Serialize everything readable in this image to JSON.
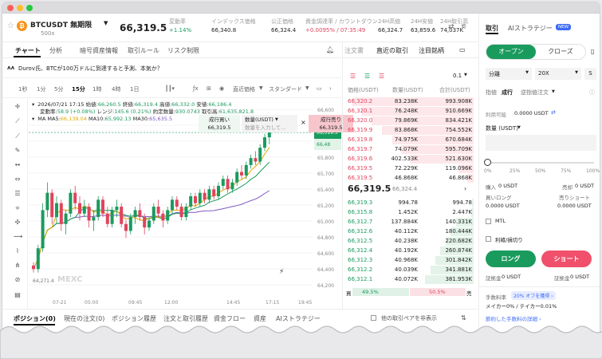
{
  "header": {
    "symbol": "BTCUSDT 無期限",
    "sub": "500x",
    "price": "66,319.5",
    "stats": [
      {
        "label": "変動率",
        "value": "+1.14%",
        "color": "green"
      },
      {
        "label": "インデックス価格",
        "value": "66,340.8",
        "color": "dark"
      },
      {
        "label": "公正価格",
        "value": "66,324.4",
        "color": "dark"
      },
      {
        "label": "資金調達率 / カウントダウン",
        "value": "+0.0095% / 07:35:49",
        "color": "red"
      },
      {
        "label": "24H高値",
        "value": "66,324.7",
        "color": "dark"
      },
      {
        "label": "24H安値",
        "value": "63,859.6",
        "color": "dark"
      },
      {
        "label": "24H取引高",
        "value": "74,037K",
        "color": "dark"
      }
    ]
  },
  "chart_tabs": [
    "チャート",
    "分析",
    "暗号資産情報",
    "取引ルール",
    "リスク制限"
  ],
  "news": "Durov氏、BTCが100万ドルに到達すると予測、本気か？",
  "intervals": [
    "1秒",
    "1分",
    "5分",
    "15分",
    "1時",
    "4時",
    "1日"
  ],
  "interval_active": "15分",
  "chart_menu": [
    "直近価格",
    "スタンダード"
  ],
  "ohlc": {
    "date": "2026/07/21 17:15",
    "open_l": "始値:",
    "open": "66,260.5",
    "close_l": "終値:",
    "close": "66,319.4",
    "high_l": "高値:",
    "high": "66,332.0",
    "low_l": "安値:",
    "low": "66,186.4",
    "chg_l": "変動率:",
    "chg": "58.9 (+0.08%)",
    "range_l": "レンジ:",
    "range": "145.6 (0.21%)",
    "vol_l": "約定数量:",
    "vol": "930.0743",
    "amt_l": "取引高:",
    "amt": "61,635,821.8"
  },
  "ma": {
    "label": "MA",
    "ma5_l": "MA5:",
    "ma5": "66,139.04",
    "ma10_l": "MA10:",
    "ma10": "65,992.13",
    "ma30_l": "MA30:",
    "ma30": "65,635.5"
  },
  "quick": {
    "buy_l": "成行買い",
    "buy": "66,319.5",
    "qty_l": "数量(USDT)",
    "qty_ph": "数量を入力して...",
    "sell_l": "成行売り",
    "sell": "66,319.5"
  },
  "price_axis": [
    "66,600",
    "66,400",
    "66,200",
    "65,800",
    "65,700",
    "65,400",
    "65,200",
    "65,000",
    "64,800",
    "64,600",
    "64,400",
    "64,200"
  ],
  "axis_current": "66,319.5",
  "axis_mark": "66,48",
  "time_axis": [
    "07-21",
    "05:00",
    "09:45",
    "12:00",
    "14:45",
    "17:15",
    "19:45"
  ],
  "chart_data": {
    "type": "candlestick",
    "low_label": "64,271.4",
    "watermark": "MEXC",
    "candles": [
      [
        64400,
        64450,
        64300,
        64350
      ],
      [
        64350,
        64700,
        64300,
        64650
      ],
      [
        64650,
        65300,
        64600,
        65200
      ],
      [
        65200,
        65600,
        65100,
        65450
      ],
      [
        65450,
        65500,
        65000,
        65100
      ],
      [
        65100,
        65400,
        65000,
        65300
      ],
      [
        65300,
        65350,
        64900,
        65000
      ],
      [
        65000,
        65200,
        64850,
        65150
      ],
      [
        65150,
        65500,
        65100,
        65450
      ],
      [
        65450,
        65550,
        65200,
        65300
      ],
      [
        65300,
        65400,
        65050,
        65150
      ],
      [
        65150,
        65350,
        65100,
        65250
      ],
      [
        65250,
        65300,
        64950,
        65050
      ],
      [
        65050,
        65200,
        64900,
        65100
      ],
      [
        65100,
        65400,
        65050,
        65350
      ],
      [
        65350,
        65400,
        65100,
        65150
      ],
      [
        65150,
        65250,
        64950,
        65000
      ],
      [
        65000,
        65250,
        64950,
        65200
      ],
      [
        65200,
        65350,
        65100,
        65250
      ],
      [
        65250,
        65300,
        64950,
        65000
      ],
      [
        65000,
        65050,
        64800,
        64900
      ],
      [
        64900,
        65150,
        64850,
        65100
      ],
      [
        65100,
        65250,
        65000,
        65200
      ],
      [
        65200,
        65300,
        65050,
        65100
      ],
      [
        65100,
        65150,
        64850,
        64950
      ],
      [
        64950,
        65100,
        64900,
        65050
      ],
      [
        65050,
        65300,
        65000,
        65250
      ],
      [
        65250,
        65350,
        65100,
        65150
      ],
      [
        65150,
        65200,
        64950,
        65050
      ],
      [
        65050,
        65250,
        65000,
        65200
      ],
      [
        65200,
        65400,
        65150,
        65350
      ],
      [
        65350,
        65400,
        65200,
        65250
      ],
      [
        65250,
        65300,
        65050,
        65100
      ],
      [
        65100,
        65300,
        65050,
        65250
      ],
      [
        65250,
        65450,
        65200,
        65400
      ],
      [
        65400,
        65450,
        65250,
        65300
      ],
      [
        65300,
        65500,
        65250,
        65450
      ],
      [
        65450,
        65500,
        65300,
        65350
      ],
      [
        65350,
        65550,
        65300,
        65500
      ],
      [
        65500,
        65550,
        65350,
        65400
      ],
      [
        65400,
        65600,
        65350,
        65550
      ],
      [
        65550,
        65700,
        65500,
        65650
      ],
      [
        65650,
        65700,
        65450,
        65500
      ],
      [
        65500,
        65650,
        65450,
        65600
      ],
      [
        65600,
        65800,
        65550,
        65750
      ],
      [
        65750,
        65850,
        65650,
        65700
      ],
      [
        65700,
        65900,
        65650,
        65850
      ],
      [
        65850,
        66000,
        65800,
        65950
      ],
      [
        65950,
        66050,
        65850,
        65900
      ],
      [
        65900,
        66150,
        65850,
        66100
      ],
      [
        66100,
        66300,
        66050,
        66250
      ],
      [
        66250,
        66350,
        66150,
        66320
      ]
    ]
  },
  "orderbook": {
    "tabs": [
      "注文書",
      "直近の取引",
      "注目銘柄"
    ],
    "precision": "0.1",
    "headers": [
      "価格(USDT)",
      "数量(USDT)",
      "合計(USDT)"
    ],
    "asks": [
      [
        "66,320.2",
        "83.238K",
        "993.908K",
        0.95
      ],
      [
        "66,320.1",
        "76.248K",
        "910.669K",
        0.88
      ],
      [
        "66,320.0",
        "79.869K",
        "834.421K",
        0.8
      ],
      [
        "66,319.9",
        "83.868K",
        "754.552K",
        0.72
      ],
      [
        "66,319.8",
        "74.975K",
        "670.684K",
        0.64
      ],
      [
        "66,319.7",
        "74.079K",
        "595.709K",
        0.57
      ],
      [
        "66,319.6",
        "402.533K",
        "521.630K",
        0.5
      ],
      [
        "66,319.5",
        "72.229K",
        "119.096K",
        0.12
      ],
      [
        "66,319.5",
        "46.868K",
        "46.868K",
        0.05
      ]
    ],
    "mid": "66,319.5",
    "mid_sub": "66,324.4",
    "bids": [
      [
        "66,319.3",
        "994.78",
        "994.78",
        0.01
      ],
      [
        "66,315.8",
        "1.452K",
        "2.447K",
        0.02
      ],
      [
        "66,312.7",
        "137.884K",
        "140.331K",
        0.14
      ],
      [
        "66,312.6",
        "40.112K",
        "180.444K",
        0.18
      ],
      [
        "66,312.5",
        "40.238K",
        "220.682K",
        0.22
      ],
      [
        "66,312.4",
        "40.192K",
        "260.874K",
        0.26
      ],
      [
        "66,312.3",
        "40.968K",
        "301.842K",
        0.3
      ],
      [
        "66,312.2",
        "40.039K",
        "341.881K",
        0.34
      ],
      [
        "66,312.1",
        "40.072K",
        "381.953K",
        0.38
      ]
    ],
    "buy_l": "買",
    "buy_pct": "49.5%",
    "sell_pct": "50.5%",
    "sell_l": "売"
  },
  "trade": {
    "tabs": [
      "取引",
      "AIストラテジー"
    ],
    "new": "NEW",
    "open": "オープン",
    "close": "クローズ",
    "margin": "分離",
    "lev": "20X",
    "s": "S",
    "order_types": [
      "指値",
      "成行",
      "逆指値注文"
    ],
    "avail_l": "利用可能",
    "avail": "0.0000 USDT",
    "qty_l": "数量 (USDT)",
    "slider": [
      "0%",
      "25%",
      "50%",
      "75%",
      "100%"
    ],
    "buy_l": "購入",
    "buy": "0 USDT",
    "sell_l": "売却",
    "sell": "0 USDT",
    "long_l": "買いロング",
    "long": "0.0000 USDT",
    "short_l": "売りショート",
    "short": "0.0000 USDT",
    "mtl": "MTL",
    "tpsl": "利確/損切り",
    "long_btn": "ロング",
    "short_btn": "ショート",
    "margin_l": "証拠金",
    "margin_v": "0 USDT",
    "margin_r": "証拠金",
    "margin_rv": "0 USDT",
    "fee_l": "手数料率",
    "fee_badge": "20% オフを獲得 ›",
    "fee": "メイカー0% / テイカー0.01%",
    "fee_link": "節約した手数料の詳細 ›"
  },
  "bottom_tabs": [
    "ポジション(0)",
    "現在の注文(0)",
    "ポジション履歴",
    "注文と取引履歴",
    "資金フロー",
    "資産",
    "AIストラテジー"
  ],
  "bottom_check": "他の取引ペアを非表示",
  "colors": {
    "green": "#1a9b5e",
    "red": "#e0445d"
  }
}
